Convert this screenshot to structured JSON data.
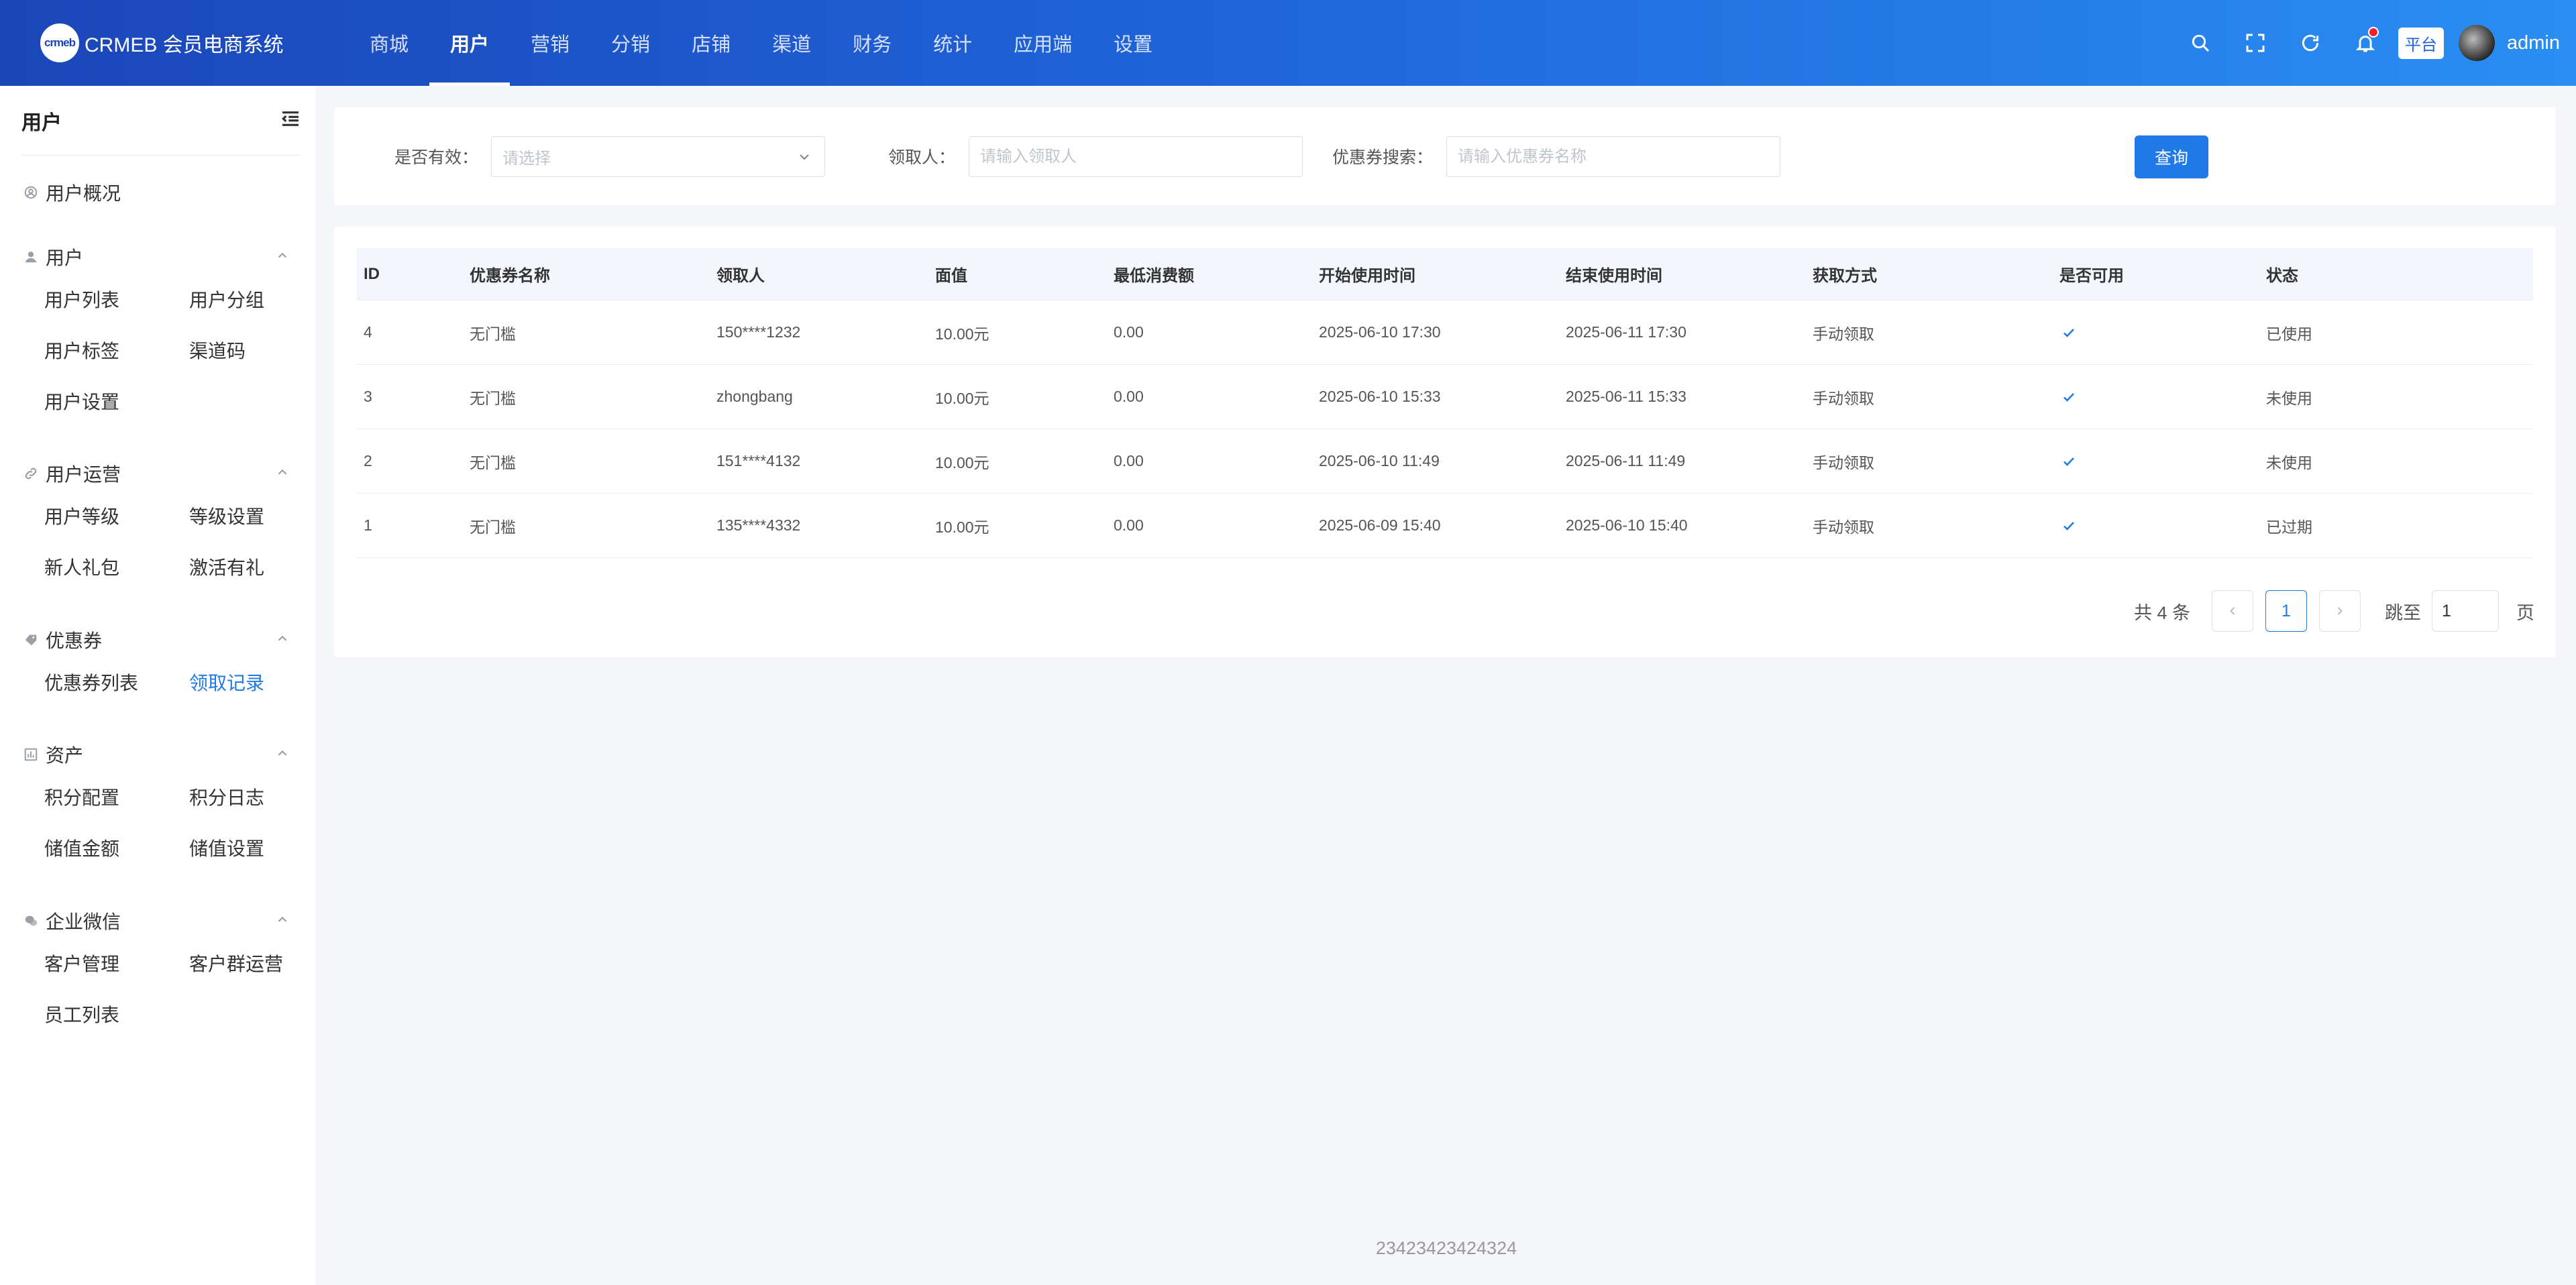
{
  "header": {
    "logo_mark": "crmeb",
    "logo_text": "CRMEB 会员电商系统",
    "nav": [
      {
        "label": "商城",
        "active": false
      },
      {
        "label": "用户",
        "active": true
      },
      {
        "label": "营销",
        "active": false
      },
      {
        "label": "分销",
        "active": false
      },
      {
        "label": "店铺",
        "active": false
      },
      {
        "label": "渠道",
        "active": false
      },
      {
        "label": "财务",
        "active": false
      },
      {
        "label": "统计",
        "active": false
      },
      {
        "label": "应用端",
        "active": false
      },
      {
        "label": "设置",
        "active": false
      }
    ],
    "platform_tag": "平台",
    "username": "admin"
  },
  "sidebar": {
    "title": "用户",
    "overview": "用户概况",
    "groups": [
      {
        "label": "用户",
        "items": [
          "用户列表",
          "用户分组",
          "用户标签",
          "渠道码",
          "用户设置"
        ]
      },
      {
        "label": "用户运营",
        "items": [
          "用户等级",
          "等级设置",
          "新人礼包",
          "激活有礼"
        ]
      },
      {
        "label": "优惠券",
        "items": [
          "优惠券列表",
          "领取记录"
        ]
      },
      {
        "label": "资产",
        "items": [
          "积分配置",
          "积分日志",
          "储值金额",
          "储值设置"
        ]
      },
      {
        "label": "企业微信",
        "items": [
          "客户管理",
          "客户群运营",
          "员工列表"
        ]
      }
    ],
    "active_item": "领取记录"
  },
  "filters": {
    "valid_label": "是否有效：",
    "valid_placeholder": "请选择",
    "receiver_label": "领取人：",
    "receiver_placeholder": "请输入领取人",
    "coupon_label": "优惠券搜索：",
    "coupon_placeholder": "请输入优惠券名称",
    "query_button": "查询"
  },
  "table": {
    "columns": [
      "ID",
      "优惠券名称",
      "领取人",
      "面值",
      "最低消费额",
      "开始使用时间",
      "结束使用时间",
      "获取方式",
      "是否可用",
      "状态"
    ],
    "rows": [
      {
        "id": "4",
        "name": "无门槛",
        "receiver": "150****1232",
        "value": "10.00元",
        "min": "0.00",
        "start": "2025-06-10 17:30",
        "end": "2025-06-11 17:30",
        "method": "手动领取",
        "usable": true,
        "status": "已使用"
      },
      {
        "id": "3",
        "name": "无门槛",
        "receiver": "zhongbang",
        "value": "10.00元",
        "min": "0.00",
        "start": "2025-06-10 15:33",
        "end": "2025-06-11 15:33",
        "method": "手动领取",
        "usable": true,
        "status": "未使用"
      },
      {
        "id": "2",
        "name": "无门槛",
        "receiver": "151****4132",
        "value": "10.00元",
        "min": "0.00",
        "start": "2025-06-10 11:49",
        "end": "2025-06-11 11:49",
        "method": "手动领取",
        "usable": true,
        "status": "未使用"
      },
      {
        "id": "1",
        "name": "无门槛",
        "receiver": "135****4332",
        "value": "10.00元",
        "min": "0.00",
        "start": "2025-06-09 15:40",
        "end": "2025-06-10 15:40",
        "method": "手动领取",
        "usable": true,
        "status": "已过期"
      }
    ]
  },
  "pagination": {
    "total": "共 4 条",
    "current": "1",
    "jump_label": "跳至",
    "jump_value": "1",
    "page_suffix": "页"
  },
  "footer": "23423423424324",
  "colors": {
    "primary": "#1f7ae8",
    "header_start": "#1b46b8",
    "header_end": "#2a8ef2"
  }
}
